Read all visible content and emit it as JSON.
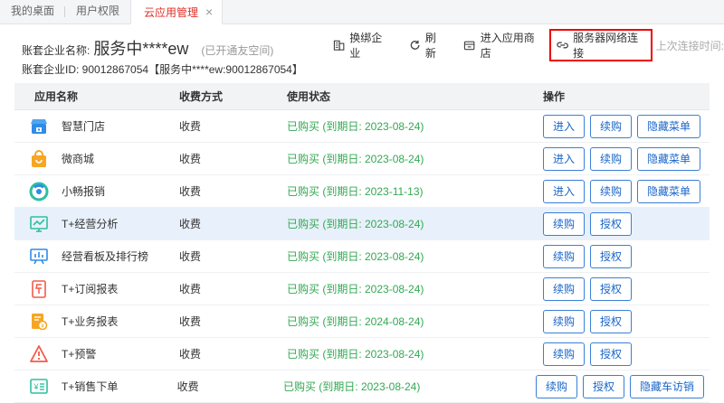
{
  "tabs": [
    {
      "label": "我的桌面"
    },
    {
      "label": "用户权限"
    },
    {
      "label": "云应用管理",
      "active": true,
      "close": "×"
    }
  ],
  "company": {
    "name_label": "账套企业名称:",
    "name": "服务中****ew",
    "status_tag": "(已开通友空间)",
    "id_line": "账套企业ID: 90012867054【服务中****ew:90012867054】"
  },
  "toolbar": {
    "rebind": "换绑企业",
    "refresh": "刷新",
    "store": "进入应用商店",
    "server_conn": "服务器网络连接",
    "last_conn": "上次连接时间:"
  },
  "table": {
    "headers": [
      "应用名称",
      "收费方式",
      "使用状态",
      "操作"
    ],
    "rows": [
      {
        "icon": "store-icon",
        "name": "智慧门店",
        "charge": "收费",
        "status": "已购买 (到期日: 2023-08-24)",
        "actions": [
          "进入",
          "续购",
          "隐藏菜单"
        ]
      },
      {
        "icon": "shopping-bag-icon",
        "name": "微商城",
        "charge": "收费",
        "status": "已购买 (到期日: 2023-08-24)",
        "actions": [
          "进入",
          "续购",
          "隐藏菜单"
        ]
      },
      {
        "icon": "expense-icon",
        "name": "小畅报销",
        "charge": "收费",
        "status": "已购买 (到期日: 2023-11-13)",
        "actions": [
          "进入",
          "续购",
          "隐藏菜单"
        ]
      },
      {
        "icon": "analytics-icon",
        "name": "T+经营分析",
        "charge": "收费",
        "status": "已购买 (到期日: 2023-08-24)",
        "actions": [
          "续购",
          "授权"
        ],
        "highlight": true
      },
      {
        "icon": "board-icon",
        "name": "经营看板及排行榜",
        "charge": "收费",
        "status": "已购买 (到期日: 2023-08-24)",
        "actions": [
          "续购",
          "授权"
        ]
      },
      {
        "icon": "subscription-report-icon",
        "name": "T+订阅报表",
        "charge": "收费",
        "status": "已购买 (到期日: 2023-08-24)",
        "actions": [
          "续购",
          "授权"
        ]
      },
      {
        "icon": "business-report-icon",
        "name": "T+业务报表",
        "charge": "收费",
        "status": "已购买 (到期日: 2024-08-24)",
        "actions": [
          "续购",
          "授权"
        ]
      },
      {
        "icon": "alarm-icon",
        "name": "T+预警",
        "charge": "收费",
        "status": "已购买 (到期日: 2023-08-24)",
        "actions": [
          "续购",
          "授权"
        ]
      },
      {
        "icon": "sales-order-icon",
        "name": "T+销售下单",
        "charge": "收费",
        "status": "已购买 (到期日: 2023-08-24)",
        "actions": [
          "续购",
          "授权",
          "隐藏车访销"
        ]
      }
    ]
  },
  "colors": {
    "accent_red": "#e02e24",
    "status_green": "#33a853",
    "button_blue": "#1a66c9",
    "icon_blue": "#2f8ce8",
    "icon_orange": "#f6a623",
    "icon_red": "#f25b4b"
  }
}
